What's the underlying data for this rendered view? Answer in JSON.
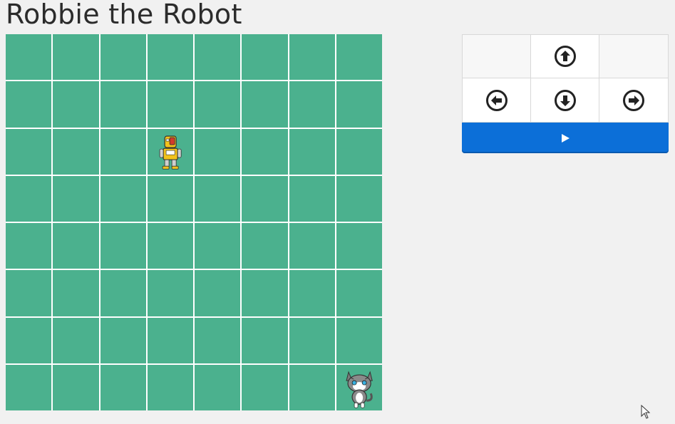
{
  "page": {
    "title": "Robbie the Robot"
  },
  "board": {
    "rows": 8,
    "cols": 8,
    "cell_color": "#4bb18e",
    "grid_line_color": "#ffffff",
    "robot": {
      "row": 2,
      "col": 3,
      "icon": "robot-icon"
    },
    "cat": {
      "row": 7,
      "col": 7,
      "icon": "cat-icon"
    }
  },
  "controls": {
    "up": {
      "icon": "arrow-up-circle-icon"
    },
    "left": {
      "icon": "arrow-left-circle-icon"
    },
    "down": {
      "icon": "arrow-down-circle-icon"
    },
    "right": {
      "icon": "arrow-right-circle-icon"
    },
    "run": {
      "icon": "play-icon",
      "color": "#0c6fd8"
    }
  }
}
